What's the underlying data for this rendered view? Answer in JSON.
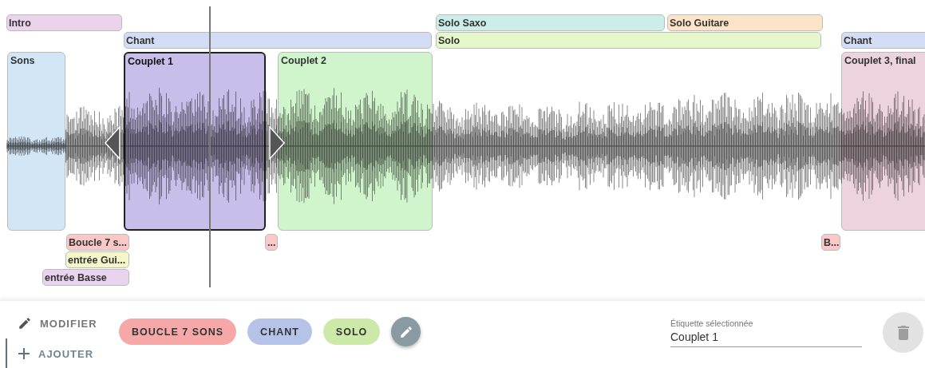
{
  "top_labels": [
    {
      "text": "Intro",
      "color": "#ecd3ec",
      "selected": false
    },
    {
      "text": "Solo Saxo",
      "color": "#cdeee8",
      "selected": false
    },
    {
      "text": "Solo Guitare",
      "color": "#fde3c8",
      "selected": false
    },
    {
      "text": "Chant",
      "color": "#d3dcf5",
      "selected": false
    },
    {
      "text": "Solo",
      "color": "#e6f7cc",
      "selected": false
    },
    {
      "text": "Chant",
      "color": "#d3dcf5",
      "selected": false
    }
  ],
  "regions": [
    {
      "text": "Sons",
      "color": "#d3e6f5",
      "selected": false
    },
    {
      "text": "Couplet 1",
      "color": "#c9bdea",
      "selected": true
    },
    {
      "text": "Couplet 2",
      "color": "#d0f4cc",
      "selected": false
    },
    {
      "text": "Couplet 3, final",
      "color": "#ecd3dd",
      "selected": false
    }
  ],
  "bottom_labels": [
    {
      "text": "Boucle 7 s...",
      "color": "#fbc8c8",
      "selected": false
    },
    {
      "text": "...",
      "color": "#fbc8c8",
      "selected": false
    },
    {
      "text": "B...",
      "color": "#fbc8c8",
      "selected": false
    },
    {
      "text": "entrée Gui...",
      "color": "#f6f7c8",
      "selected": false
    },
    {
      "text": "entrée Basse",
      "color": "#ead3ef",
      "selected": false
    }
  ],
  "modes": [
    {
      "kind": "edit",
      "label": "MODIFIER",
      "selected": false
    },
    {
      "kind": "add",
      "label": "AJOUTER",
      "selected": true
    }
  ],
  "chips": [
    {
      "label": "BOUCLE 7 SONS",
      "color": "#f6a8a8"
    },
    {
      "label": "CHANT",
      "color": "#b5c3e8"
    },
    {
      "label": "SOLO",
      "color": "#cde9a8"
    }
  ],
  "selected_field": {
    "label": "Étiquette sélectionnée",
    "value": "Couplet 1"
  },
  "delete_button": {
    "disabled": true
  }
}
